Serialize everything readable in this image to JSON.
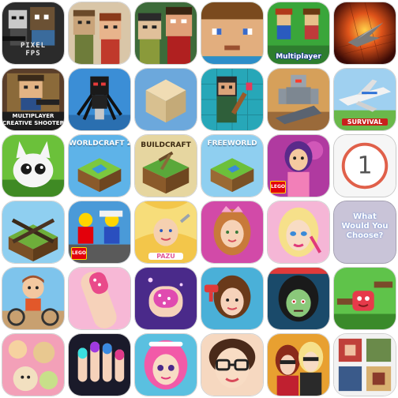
{
  "apps": [
    {
      "id": "pixel-fps",
      "label": "PIXEL\nFPS"
    },
    {
      "id": "blocky-duo",
      "label": ""
    },
    {
      "id": "block-heroes",
      "label": ""
    },
    {
      "id": "skin-face",
      "label": ""
    },
    {
      "id": "multiplayer-pixels",
      "label": "Multiplayer"
    },
    {
      "id": "fire-plane",
      "label": ""
    },
    {
      "id": "multiplayer-creative-shooter",
      "label": "MULTIPLAYER\nCREATIVE SHOOTER"
    },
    {
      "id": "spider-skin",
      "label": ""
    },
    {
      "id": "sand-block",
      "label": ""
    },
    {
      "id": "painter-skin",
      "label": ""
    },
    {
      "id": "robot-attack",
      "label": ""
    },
    {
      "id": "plane-survival",
      "label": "SURVIVAL"
    },
    {
      "id": "furry-creature",
      "label": ""
    },
    {
      "id": "worldcraft-2",
      "label": "WORLDCRAFT 2"
    },
    {
      "id": "buildcraft",
      "label": "BUILDCRAFT"
    },
    {
      "id": "freeworld",
      "label": "FREEWORLD"
    },
    {
      "id": "lego-friends-singer",
      "label": "LEGO"
    },
    {
      "id": "number-one",
      "label": "1"
    },
    {
      "id": "crossed-rifles",
      "label": ""
    },
    {
      "id": "lego-city",
      "label": "LEGO"
    },
    {
      "id": "pazu-salon",
      "label": "PAZU"
    },
    {
      "id": "princess-makeover",
      "label": ""
    },
    {
      "id": "blonde-makeup",
      "label": ""
    },
    {
      "id": "would-you-choose",
      "label": "What\nWould You\nChoose?"
    },
    {
      "id": "boy-bike",
      "label": ""
    },
    {
      "id": "nail-salon",
      "label": ""
    },
    {
      "id": "glitter-nails",
      "label": ""
    },
    {
      "id": "hair-dryer-girl",
      "label": ""
    },
    {
      "id": "zombie-girl",
      "label": ""
    },
    {
      "id": "jelly-jump",
      "label": ""
    },
    {
      "id": "toy-shop",
      "label": ""
    },
    {
      "id": "neon-nails",
      "label": ""
    },
    {
      "id": "pink-hair-girl",
      "label": ""
    },
    {
      "id": "glasses-girl",
      "label": ""
    },
    {
      "id": "fashion-duo",
      "label": ""
    },
    {
      "id": "photo-collage",
      "label": ""
    }
  ],
  "colors": {
    "sky": "#7fb6e6",
    "grass": "#5ca838",
    "pink": "#f27fb8",
    "purple": "#8a4cc9",
    "lego_red": "#e3000b"
  }
}
